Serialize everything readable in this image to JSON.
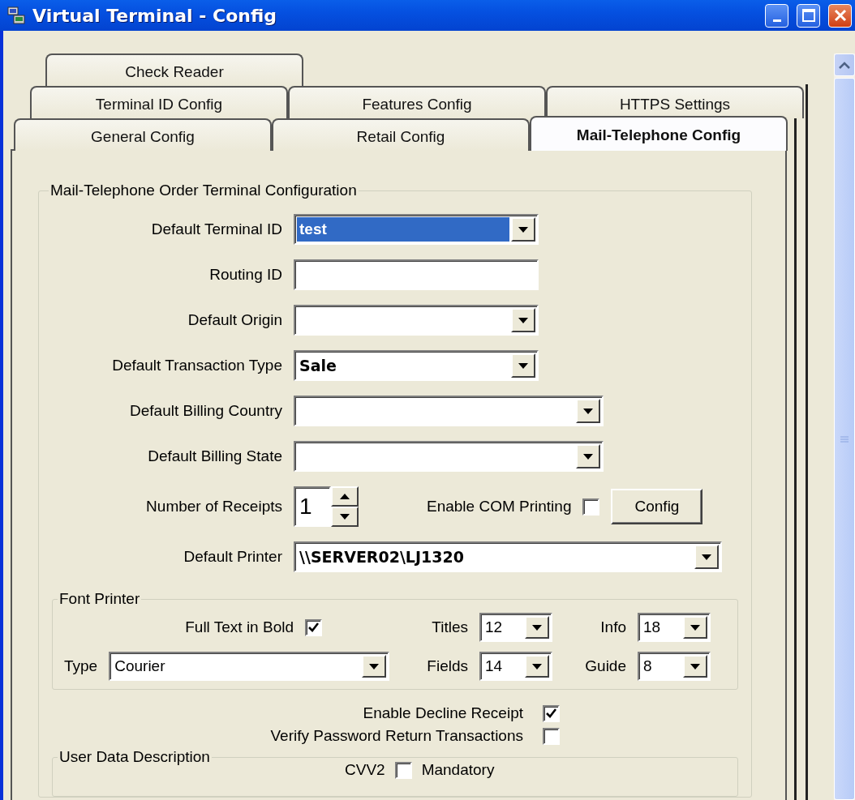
{
  "window": {
    "title": "Virtual Terminal - Config"
  },
  "tab_rows": [
    {
      "tabs": [
        {
          "label": "Check Reader",
          "selected": false
        }
      ]
    },
    {
      "tabs": [
        {
          "label": "Terminal ID Config",
          "selected": false
        },
        {
          "label": "Features Config",
          "selected": false
        },
        {
          "label": "HTTPS Settings",
          "selected": false
        }
      ]
    },
    {
      "tabs": [
        {
          "label": "General Config",
          "selected": false
        },
        {
          "label": "Retail Config",
          "selected": false
        },
        {
          "label": "Mail-Telephone Config",
          "selected": true
        }
      ]
    }
  ],
  "group": {
    "title": "Mail-Telephone Order Terminal Configuration",
    "fields": [
      {
        "label": "Default Terminal ID",
        "kind": "combo",
        "value": "test",
        "highlighted": true
      },
      {
        "label": "Routing ID",
        "kind": "input"
      },
      {
        "label": "Default Origin",
        "kind": "combo"
      },
      {
        "label": "Default Transaction Type",
        "kind": "combo",
        "value": "Sale",
        "highlighted": false
      },
      {
        "label": "Default Billing Country",
        "kind": "combo"
      },
      {
        "label": "Default Billing State",
        "kind": "combo"
      }
    ],
    "receipts": {
      "label": "Number of Receipts",
      "value": "1"
    },
    "com_printing": {
      "label": "Enable COM Printing",
      "checked": false
    },
    "config_button": "Config",
    "printer": {
      "label": "Default Printer",
      "value": "\\\\SERVER02\\LJ1320"
    },
    "font_printer": {
      "title": "Font Printer",
      "full_bold": {
        "label": "Full Text in Bold",
        "checked": true
      },
      "type": {
        "label": "Type",
        "value": "Courier"
      },
      "sizes": [
        {
          "label": "Titles",
          "value": "12"
        },
        {
          "label": "Info",
          "value": "18"
        },
        {
          "label": "Fields",
          "value": "14"
        },
        {
          "label": "Guide",
          "value": "8"
        }
      ]
    },
    "options": [
      {
        "label": "Enable Decline Receipt",
        "checked": true
      },
      {
        "label": "Verify Password Return Transactions",
        "checked": false
      }
    ],
    "user_data": {
      "title": "User Data Description",
      "cvv2": {
        "label": "CVV2",
        "checked": false,
        "suffix": "Mandatory"
      }
    }
  }
}
